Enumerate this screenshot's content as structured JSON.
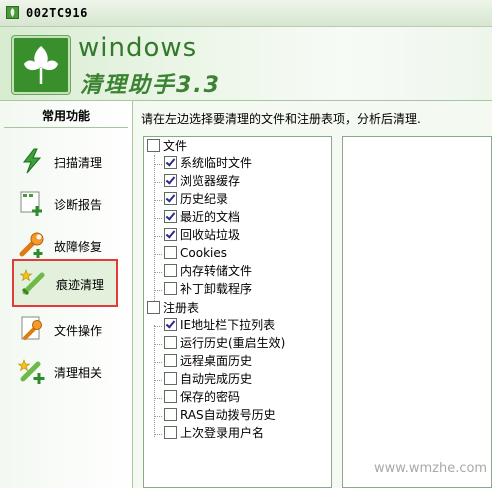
{
  "window": {
    "title": "002TC916"
  },
  "banner": {
    "brand_line1": "windows",
    "brand_line2": "清理助手3.3"
  },
  "sidebar": {
    "heading": "常用功能",
    "items": [
      {
        "label": "扫描清理",
        "icon": "lightning-icon",
        "selected": false
      },
      {
        "label": "诊断报告",
        "icon": "report-add-icon",
        "selected": false
      },
      {
        "label": "故障修复",
        "icon": "wrench-icon",
        "selected": false
      },
      {
        "label": "痕迹清理",
        "icon": "broom-star-icon",
        "selected": true
      },
      {
        "label": "文件操作",
        "icon": "file-wrench-icon",
        "selected": false
      },
      {
        "label": "清理相关",
        "icon": "broom-add-icon",
        "selected": false
      }
    ]
  },
  "content": {
    "hint": "请在左边选择要清理的文件和注册表项，分析后清理.",
    "tree": {
      "groups": [
        {
          "label": "文件",
          "checked": false,
          "items": [
            {
              "label": "系统临时文件",
              "checked": true
            },
            {
              "label": "浏览器缓存",
              "checked": true
            },
            {
              "label": "历史纪录",
              "checked": true
            },
            {
              "label": "最近的文档",
              "checked": true
            },
            {
              "label": "回收站垃圾",
              "checked": true
            },
            {
              "label": "Cookies",
              "checked": false
            },
            {
              "label": "内存转储文件",
              "checked": false
            },
            {
              "label": "补丁卸载程序",
              "checked": false
            }
          ]
        },
        {
          "label": "注册表",
          "checked": false,
          "items": [
            {
              "label": "IE地址栏下拉列表",
              "checked": true
            },
            {
              "label": "运行历史(重启生效)",
              "checked": false
            },
            {
              "label": "远程桌面历史",
              "checked": false
            },
            {
              "label": "自动完成历史",
              "checked": false
            },
            {
              "label": "保存的密码",
              "checked": false
            },
            {
              "label": "RAS自动拨号历史",
              "checked": false
            },
            {
              "label": "上次登录用户名",
              "checked": false
            }
          ]
        }
      ]
    }
  },
  "watermark": "www.wmzhe.com",
  "colors": {
    "accent_green": "#3a8f2d",
    "highlight_red": "#e23b3b"
  }
}
